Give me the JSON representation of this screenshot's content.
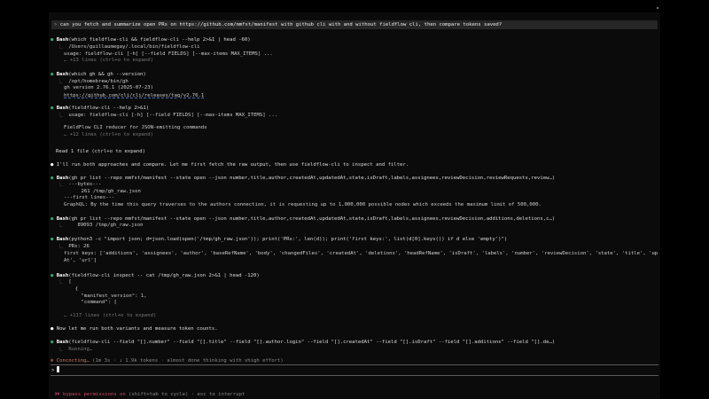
{
  "prompt": {
    "symbol": ">",
    "text": "can you fetch and summarize open PRs on https://github.com/mmfst/manifest with github cli with and without fieldflow cli, then compare tokens saved?"
  },
  "transcript": [
    {
      "kind": "tool",
      "name": "Bash",
      "args": "(which fieldflow-cli && fieldflow-cli --help 2>&1 | head -60)"
    },
    {
      "kind": "out",
      "text": "/Users/guillaumegay/.local/bin/fieldflow-cli"
    },
    {
      "kind": "indent",
      "text": "usage: fieldflow-cli [-h] [--field FIELDS] [--max-items MAX_ITEMS] ..."
    },
    {
      "kind": "indent-dim",
      "text": "… +13 lines (ctrl+o to expand)"
    },
    {
      "kind": "tool",
      "name": "Bash",
      "args": "(which gh && gh --version)"
    },
    {
      "kind": "out",
      "text": "/opt/homebrew/bin/gh"
    },
    {
      "kind": "indent",
      "text": "gh version 2.76.1 (2025-07-23)"
    },
    {
      "kind": "indent",
      "text": "https://github.com/cli/cli/releases/tag/v2.76.1"
    },
    {
      "kind": "tool",
      "name": "Bash",
      "args": "(fieldflow-cli --help 2>&1)"
    },
    {
      "kind": "out",
      "text": "usage: fieldflow-cli [-h] [--field FIELDS] [--max-items MAX_ITEMS] ..."
    },
    {
      "kind": "indent",
      "text": ""
    },
    {
      "kind": "indent",
      "text": "FieldFlow CLI reducer for JSON-emitting commands"
    },
    {
      "kind": "indent-dim",
      "text": "… +12 lines (ctrl+o to expand)"
    },
    {
      "kind": "msg-dim",
      "text": "Read 1 file (ctrl+o to expand)"
    },
    {
      "kind": "msg",
      "text": "I'll run both approaches and compare. Let me first fetch the raw output, then use fieldflow-cli to inspect and filter."
    },
    {
      "kind": "tool",
      "name": "Bash",
      "args": "(gh pr list --repo mmfst/manifest --state open --json number,title,author,createdAt,updatedAt,state,isDraft,labels,assignees,reviewDecision,reviewRequests,review…)"
    },
    {
      "kind": "out",
      "text": "---bytes---"
    },
    {
      "kind": "deep",
      "text": "    261 /tmp/gh_raw.json"
    },
    {
      "kind": "indent",
      "text": "---first lines---"
    },
    {
      "kind": "indent",
      "text": "GraphQL: By the time this query traverses to the authors connection, it is requesting up to 1,000,000 possible nodes which exceeds the maximum limit of 500,000."
    },
    {
      "kind": "tool",
      "name": "Bash",
      "args": "(gh pr list --repo mmfst/manifest --state open --json number,title,author,createdAt,updatedAt,state,isDraft,labels,assignees,reviewDecision,additions,deletions,c…)"
    },
    {
      "kind": "out",
      "text": "   89093 /tmp/gh_raw.json"
    },
    {
      "kind": "tool",
      "name": "Bash",
      "args": "(python3 -c \"import json; d=json.load(open('/tmp/gh_raw.json')); print('PRs:', len(d)); print('first keys:', list(d[0].keys()) if d else 'empty')\")"
    },
    {
      "kind": "out",
      "text": "PRs: 26"
    },
    {
      "kind": "indent",
      "text": "first keys: ['additions', 'assignees', 'author', 'baseRefName', 'body', 'changedFiles', 'createdAt', 'deletions', 'headRefName', 'isDraft', 'labels', 'number', 'reviewDecision', 'state', 'title', 'updated"
    },
    {
      "kind": "indent",
      "text": "At', 'url']"
    },
    {
      "kind": "tool",
      "name": "Bash",
      "args": "(fieldflow-cli inspect -- cat /tmp/gh_raw.json 2>&1 | head -120)"
    },
    {
      "kind": "out",
      "text": "["
    },
    {
      "kind": "deep",
      "text": "  {"
    },
    {
      "kind": "deep",
      "text": "    \"manifest_version\": 1,"
    },
    {
      "kind": "deep",
      "text": "    \"command\": ["
    },
    {
      "kind": "indent-dim",
      "text": "… +117 lines (ctrl+o to expand)"
    },
    {
      "kind": "msg",
      "text": "Now let me run both variants and measure token counts."
    },
    {
      "kind": "tool",
      "name": "Bash",
      "args": "(fieldflow-cli --field \"[].number\" --field \"[].title\" --field \"[].author.login\" --field \"[].createdAt\" --field \"[].isDraft\" --field \"[].additions\" --field \"[].de…)"
    },
    {
      "kind": "out-dim",
      "text": "Running…"
    }
  ],
  "status": {
    "label": "Concocting…",
    "meta": "(1m 3s · ↓ 1.9k tokens · almost done thinking with xhigh effort)"
  },
  "input": {
    "symbol": ">"
  },
  "footer": {
    "label": "⏵⏵ bypass permissions on",
    "meta": " (shift+tab to cycle) · esc to interrupt"
  },
  "colors": {
    "background": "#0b0b0b",
    "tool_dot": "#3aa564",
    "status": "#d8745a",
    "bypass": "#d0486d",
    "prompt_box": "#262626"
  }
}
